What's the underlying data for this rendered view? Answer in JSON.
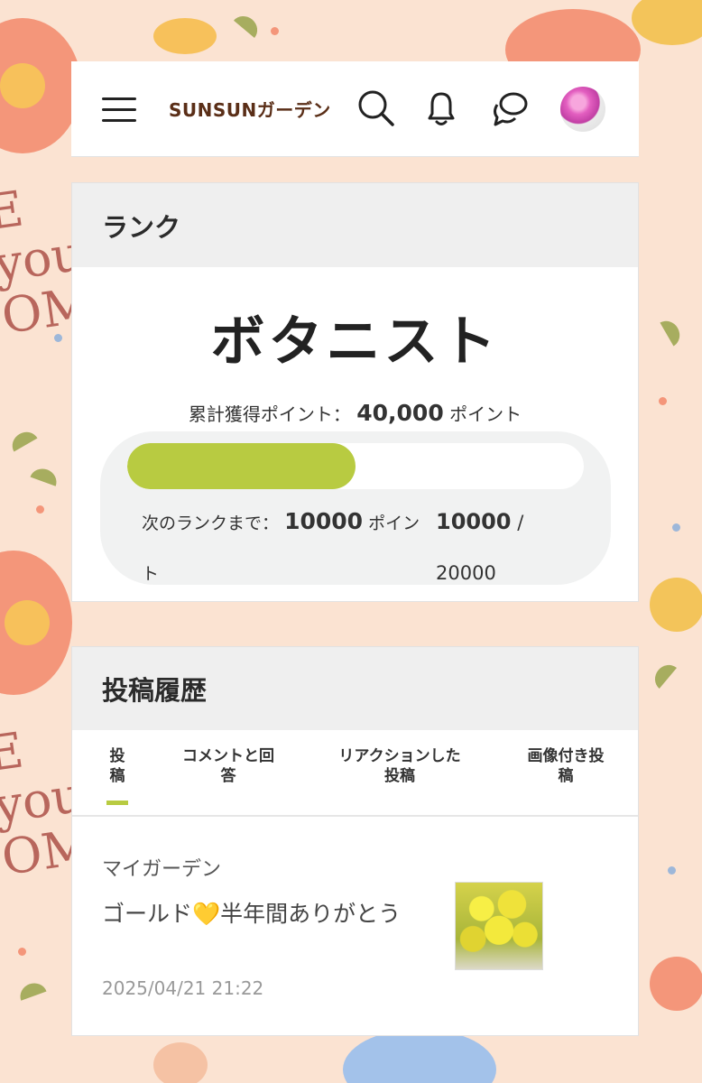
{
  "background": {
    "text_left_top": "E\nyou\nOM",
    "text_left_bottom": "E\nyou\nOM"
  },
  "header": {
    "logo_text": "SUNSUNガーデン",
    "icons": [
      "menu-icon",
      "search-icon",
      "bell-icon",
      "chat-icon"
    ]
  },
  "rank": {
    "section_title": "ランク",
    "rank_name": "ボタニスト",
    "total_points_label": "累計獲得ポイント：",
    "total_points_value": "40,000",
    "total_points_unit": "ポイント",
    "progress_fraction": 0.5,
    "next_rank_label": "次のランクまで：",
    "next_rank_value": "10000",
    "next_rank_unit": "ポイント",
    "current": "10000",
    "separator": "/",
    "target": "20000"
  },
  "posts": {
    "section_title": "投稿履歴",
    "tabs": [
      {
        "label": "投\n稿",
        "active": true
      },
      {
        "label": "コメントと回\n答",
        "active": false
      },
      {
        "label": "リアクションした\n投稿",
        "active": false
      },
      {
        "label": "画像付き投\n稿",
        "active": false
      }
    ],
    "items": [
      {
        "category": "マイガーデン",
        "title": "ゴールド💛半年間ありがとう",
        "date": "2025/04/21 21:22"
      }
    ]
  },
  "colors": {
    "accent": "#b8cb41",
    "page_bg": "#fbe3d2",
    "logo": "#5a2e17"
  }
}
